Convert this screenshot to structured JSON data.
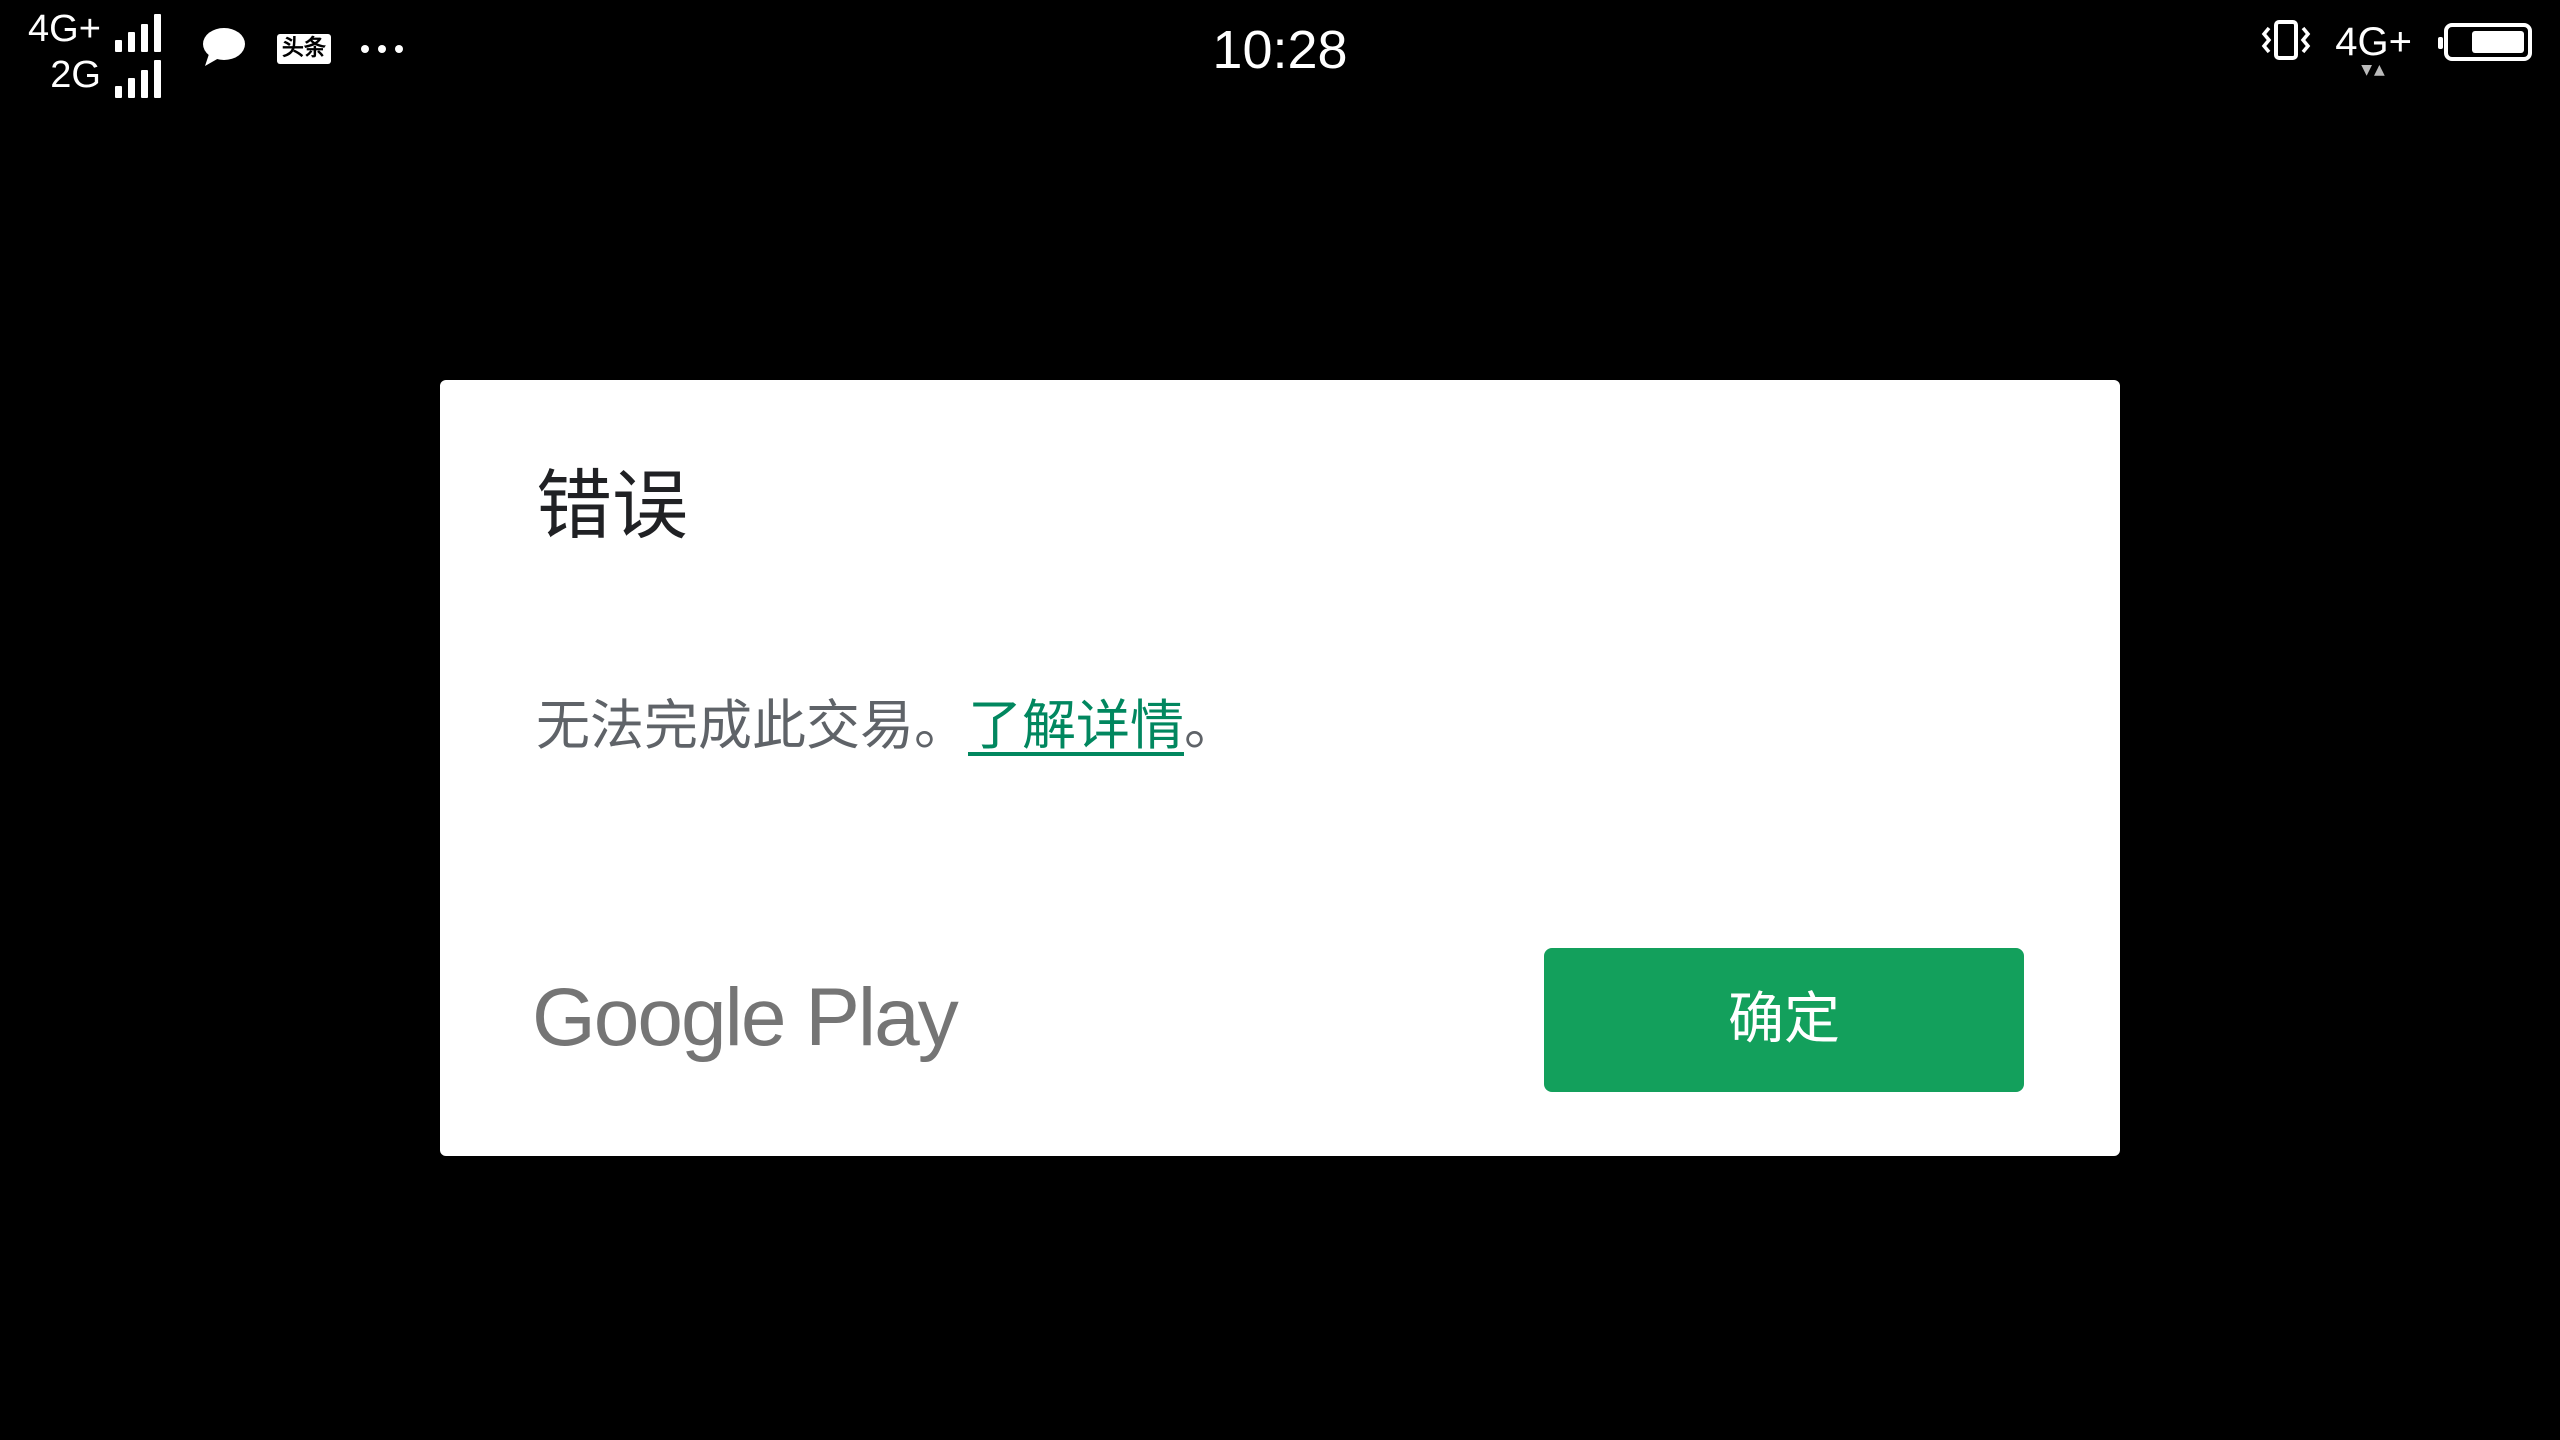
{
  "status_bar": {
    "networks_left": [
      {
        "type": "4G+",
        "signal_level": 4
      },
      {
        "type": "2G",
        "signal_level": 4
      }
    ],
    "notification_icons": [
      "chat-bubble-icon",
      "toutiao-icon",
      "more-dots-icon"
    ],
    "toutiao_label": "头条",
    "time": "10:28",
    "vibrate_icon": "vibrate-icon",
    "network_right": "4G+",
    "data_arrows": "▼▲",
    "battery_level": 0.72
  },
  "dialog": {
    "title": "错误",
    "message_text": "无法完成此交易。",
    "learn_more_link": "了解详情",
    "message_suffix": "。",
    "brand": "Google Play",
    "ok_button_label": "确定"
  },
  "colors": {
    "background": "#000000",
    "dialog_background": "#ffffff",
    "title_text": "#202124",
    "body_text": "#5f6368",
    "link": "#01875f",
    "button": "#13a05c",
    "button_text": "#ffffff",
    "brand_text": "#757575"
  }
}
